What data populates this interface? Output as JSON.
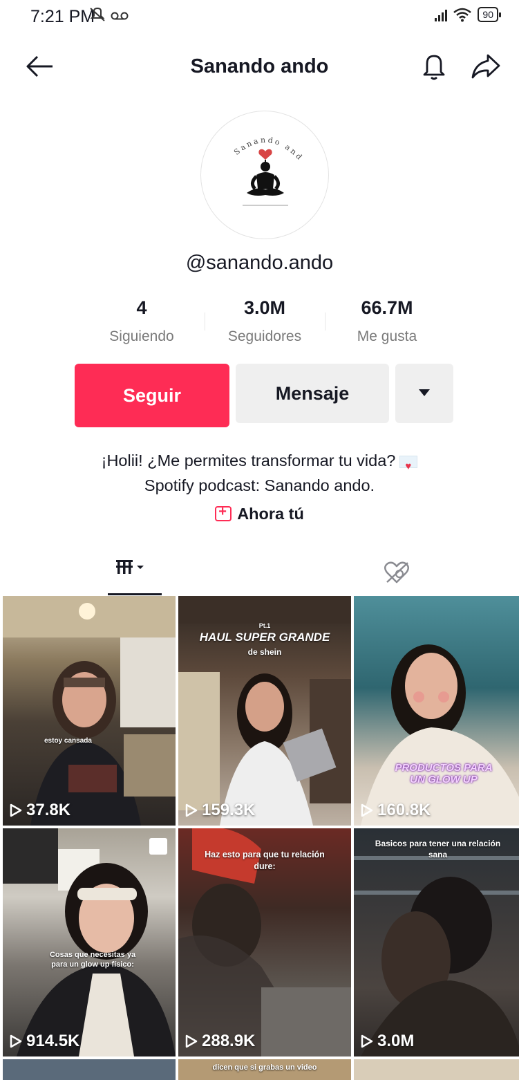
{
  "status_bar": {
    "time": "7:21 PM",
    "icons": [
      "mute-icon",
      "voicemail-icon",
      "signal-icon",
      "wifi-icon",
      "battery-icon"
    ],
    "battery": "90"
  },
  "header": {
    "title": "Sanando ando",
    "icons": [
      "back-arrow-icon",
      "bell-icon",
      "share-icon"
    ]
  },
  "profile": {
    "avatar_logo_text": "Sanando ando",
    "username": "@sanando.ando"
  },
  "stats": [
    {
      "value": "4",
      "label": "Siguiendo"
    },
    {
      "value": "3.0M",
      "label": "Seguidores"
    },
    {
      "value": "66.7M",
      "label": "Me gusta"
    }
  ],
  "actions": {
    "follow": "Seguir",
    "message": "Mensaje"
  },
  "bio": {
    "line1": "¡Holii! ¿Me permites transformar tu vida?",
    "line2": "Spotify podcast: Sanando ando.",
    "link": "Ahora tú"
  },
  "colors": {
    "accent": "#fe2c55",
    "secondary_button": "#efefef",
    "text": "#161823",
    "muted": "#7a7a7a"
  },
  "videos": [
    {
      "views": "37.8K",
      "caption": "estoy cansada"
    },
    {
      "views": "159.3K",
      "caption": "HAUL SUPER GRANDE",
      "caption2": "de shein",
      "caption_top": "Pt.1"
    },
    {
      "views": "160.8K",
      "caption": "PRODUCTOS PARA UN GLOW UP"
    },
    {
      "views": "914.5K",
      "caption": "Cosas que necesitas ya para un glow up físico:"
    },
    {
      "views": "288.9K",
      "caption": "Haz esto para que tu relación dure:"
    },
    {
      "views": "3.0M",
      "caption": "Basicos para tener una relación sana"
    }
  ],
  "partial_row_caption": "dicen que si grabas un video"
}
